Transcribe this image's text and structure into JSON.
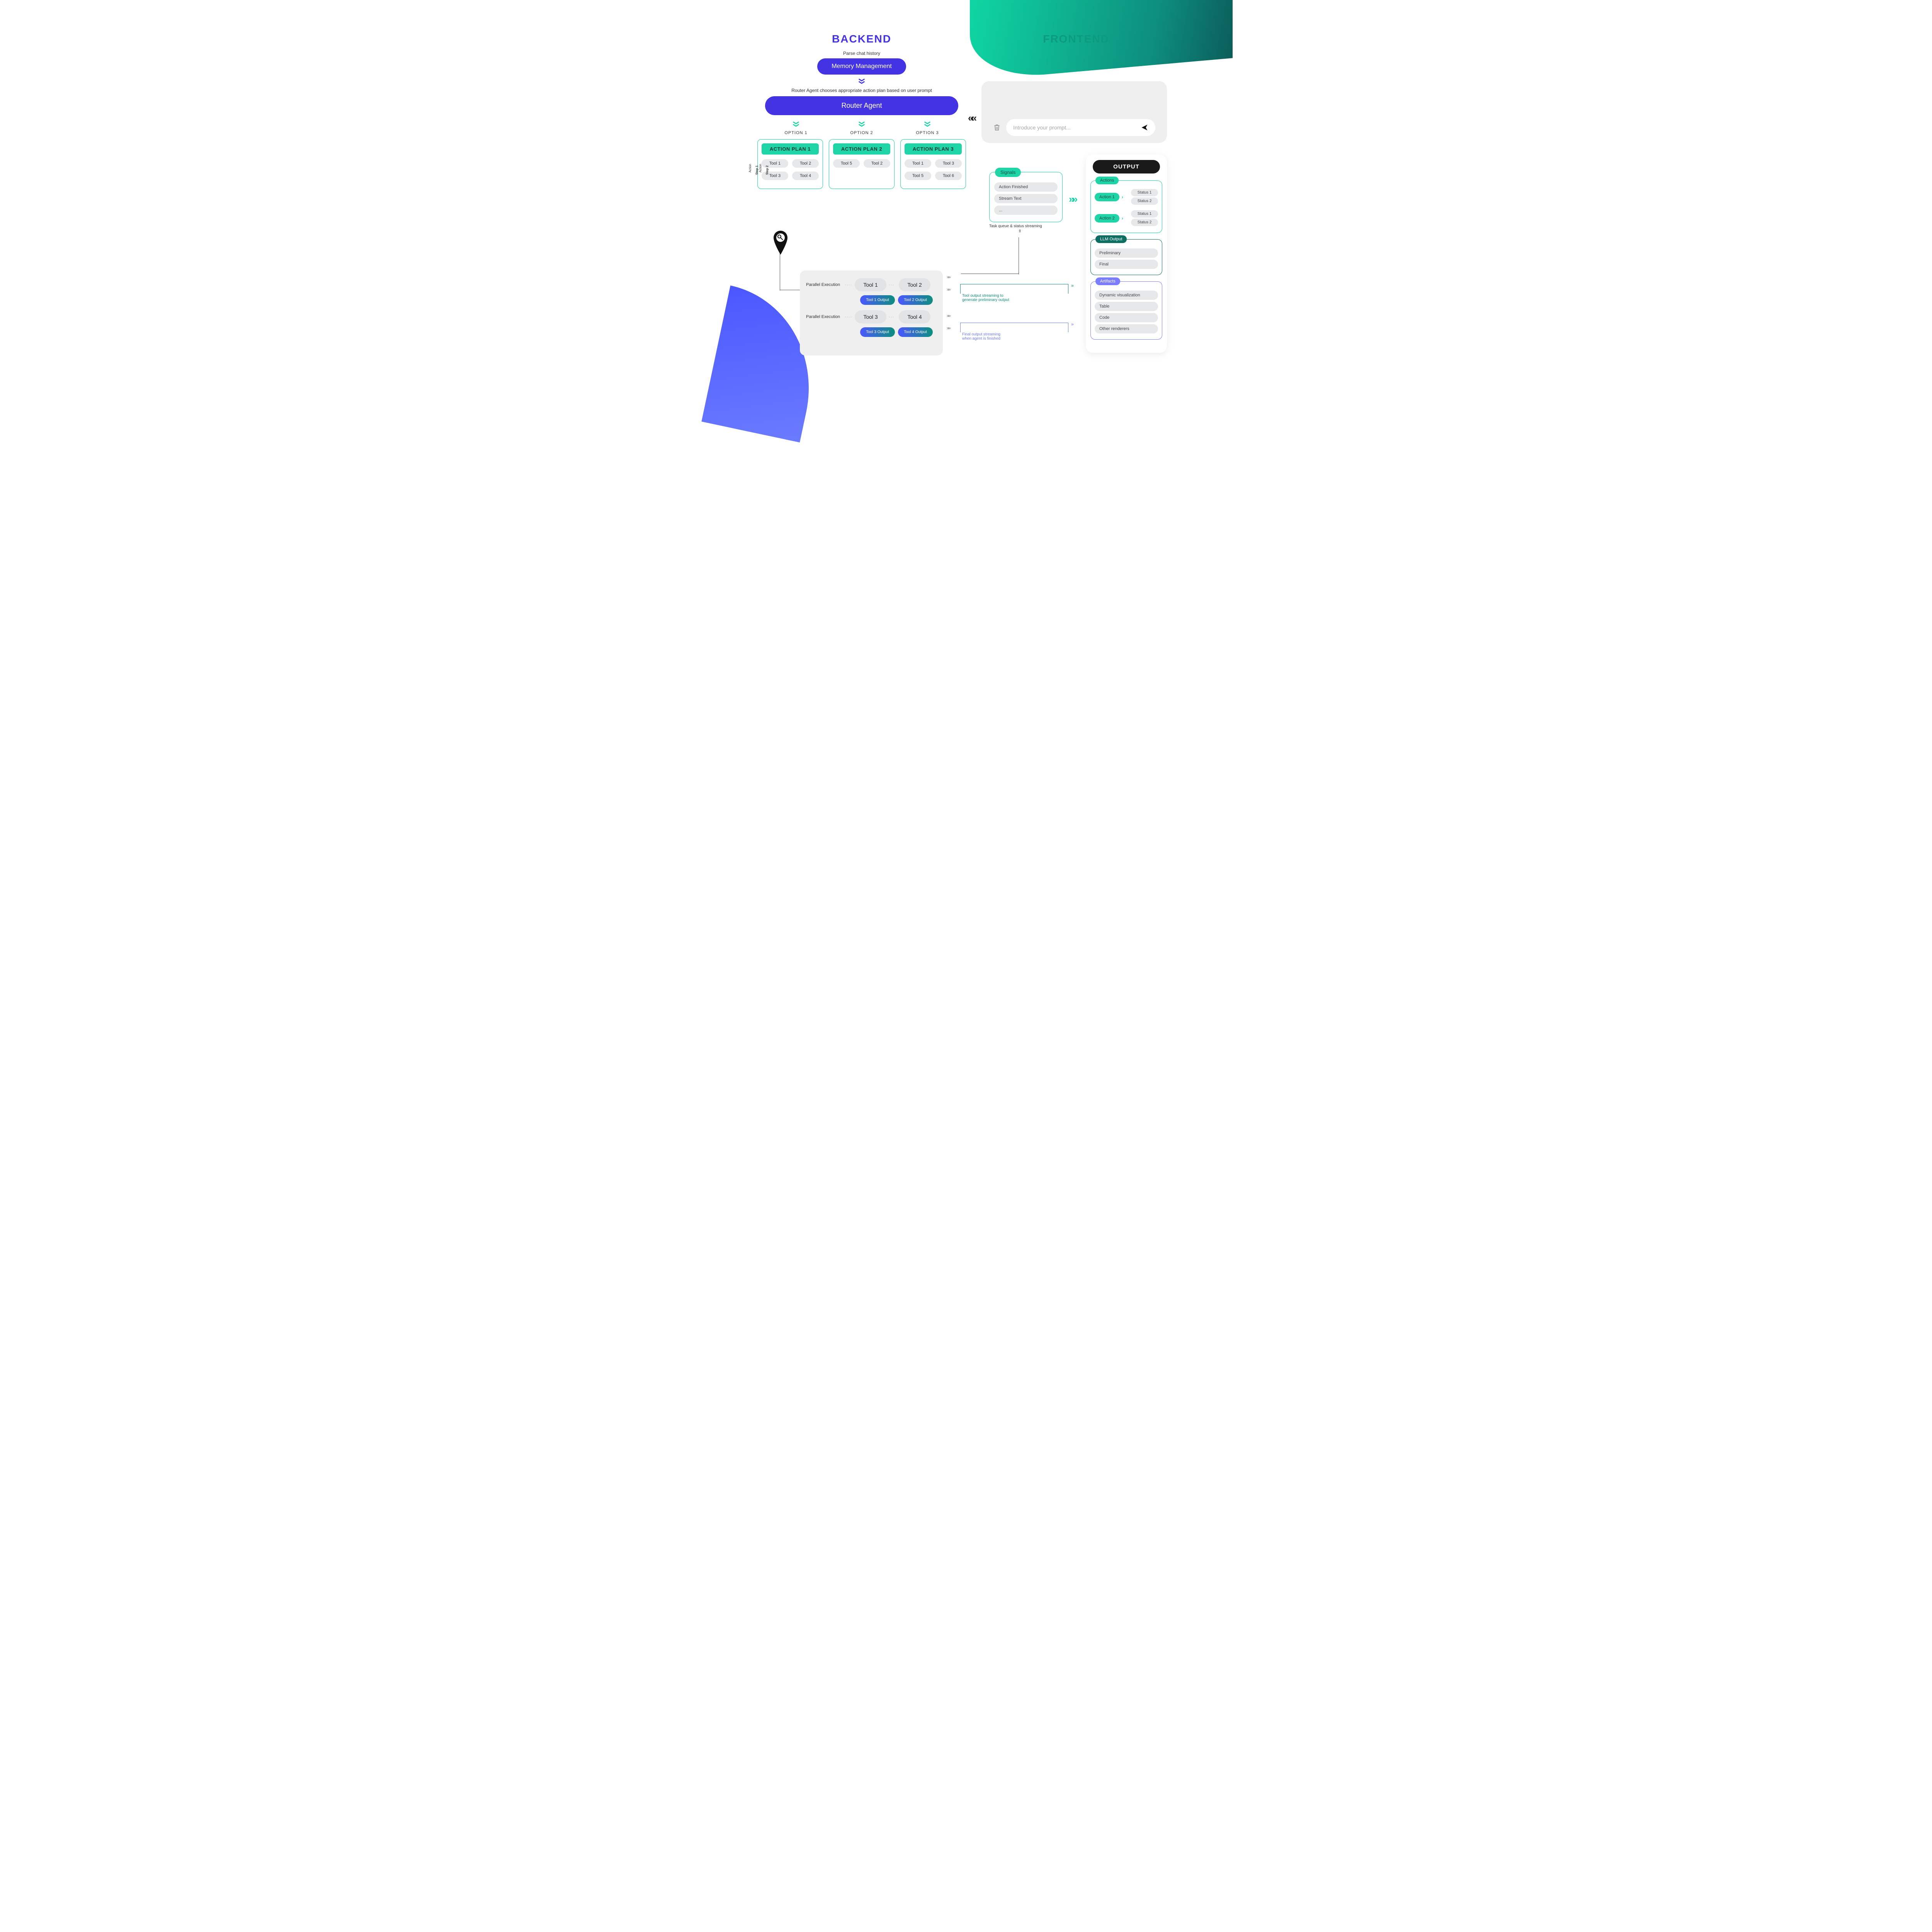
{
  "backend": {
    "title": "BACKEND",
    "parse_label": "Parse chat history",
    "memory_label": "Memory Management",
    "router_caption": "Router Agent chooses appropriate action plan based on user prompt",
    "router_label": "Router Agent",
    "options": [
      "OPTION 1",
      "OPTION 2",
      "OPTION 3"
    ],
    "step_label_1a": "Action",
    "step_label_1b": "Step 1",
    "step_label_2a": "Action",
    "step_label_2b": "Step 2",
    "plans": [
      {
        "header": "ACTION PLAN 1",
        "rows": [
          [
            "Tool 1",
            "Tool 2"
          ],
          [
            "Tool 3",
            "Tool 4"
          ]
        ]
      },
      {
        "header": "ACTION PLAN 2",
        "rows": [
          [
            "Tool 5",
            "Tool 2"
          ]
        ]
      },
      {
        "header": "ACTION PLAN 3",
        "rows": [
          [
            "Tool 1",
            "Tool 3"
          ],
          [
            "Tool 5",
            "Tool 6"
          ]
        ]
      }
    ],
    "exec": {
      "parallel_label": "Parallel Execution",
      "r1": [
        "Tool 1",
        "Tool 2"
      ],
      "r1_out": [
        "Tool 1 Output",
        "Tool 2 Output"
      ],
      "r2": [
        "Tool 3",
        "Tool 4"
      ],
      "r2_out": [
        "Tool 3 Output",
        "Tool 4 Output"
      ]
    }
  },
  "frontend": {
    "title": "FRONTEND",
    "prompt_placeholder": "Introduce your prompt...",
    "signals": {
      "tag": "Signals",
      "items": [
        "Action Finished",
        "Stream Text",
        "..."
      ],
      "caption": "Task queue & status streaming"
    },
    "output": {
      "title": "OUTPUT",
      "actions": {
        "tag": "Actions",
        "rows": [
          {
            "name": "Action 1",
            "statuses": [
              "Status 1",
              "Status 2"
            ]
          },
          {
            "name": "Action 2",
            "statuses": [
              "Status 1",
              "Status 2"
            ]
          }
        ]
      },
      "llm": {
        "tag": "LLM Output",
        "items": [
          "Preliminary",
          "Final"
        ]
      },
      "artifacts": {
        "tag": "Artifacts",
        "items": [
          "Dynamic visualization",
          "Table",
          "Code",
          "Other renderers"
        ]
      }
    },
    "stream1": "Tool output streaming to\ngenerate preliminary output",
    "stream2": "Final output streaming\nwhen agent is finished"
  }
}
